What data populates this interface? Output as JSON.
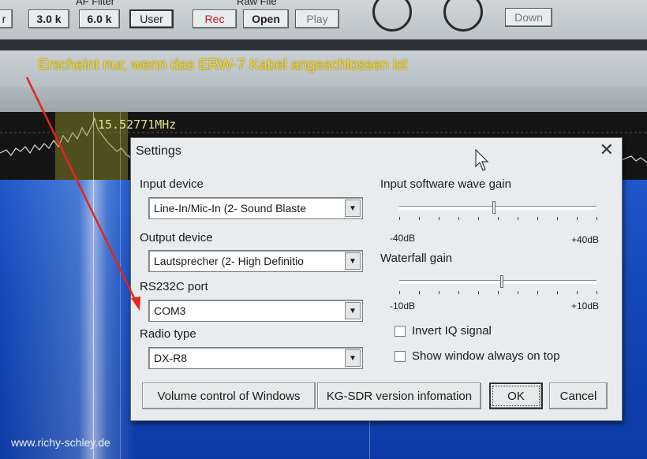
{
  "toolbar": {
    "af_filter_label": "AF Filter",
    "raw_file_label": "Raw File",
    "buttons": {
      "left_partial": "r",
      "bw_3k": "3.0 k",
      "bw_6k": "6.0 k",
      "user": "User",
      "rec": "Rec",
      "open": "Open",
      "play": "Play",
      "down": "Down"
    }
  },
  "annotation": {
    "caption": "Erscheint nur, wenn das ERW-7 Kabel angeschlossen ist"
  },
  "spectrum": {
    "frequency": "15.52771MHz"
  },
  "watermark": "www.richy-schley.de",
  "dialog": {
    "title": "Settings",
    "close": "✕",
    "input_device": {
      "label": "Input device",
      "value": "Line-In/Mic-In (2- Sound Blaste"
    },
    "output_device": {
      "label": "Output device",
      "value": "Lautsprecher (2- High Definitio"
    },
    "rs232c_port": {
      "label": "RS232C port",
      "value": "COM3"
    },
    "radio_type": {
      "label": "Radio type",
      "value": "DX-R8"
    },
    "input_gain": {
      "label": "Input software wave gain",
      "min": "-40dB",
      "max": "+40dB",
      "position": 0.48
    },
    "waterfall_gain": {
      "label": "Waterfall gain",
      "min": "-10dB",
      "max": "+10dB",
      "position": 0.52
    },
    "invert_iq": {
      "label": "Invert IQ signal",
      "checked": false
    },
    "always_on_top": {
      "label": "Show window always on top",
      "checked": false
    },
    "buttons": {
      "volume": "Volume control of Windows",
      "version": "KG-SDR version infomation",
      "ok": "OK",
      "cancel": "Cancel"
    }
  },
  "colors": {
    "caption": "#f2d52a",
    "annotation_arrow": "#e8231b",
    "waterfall": "#1a4fc0"
  }
}
